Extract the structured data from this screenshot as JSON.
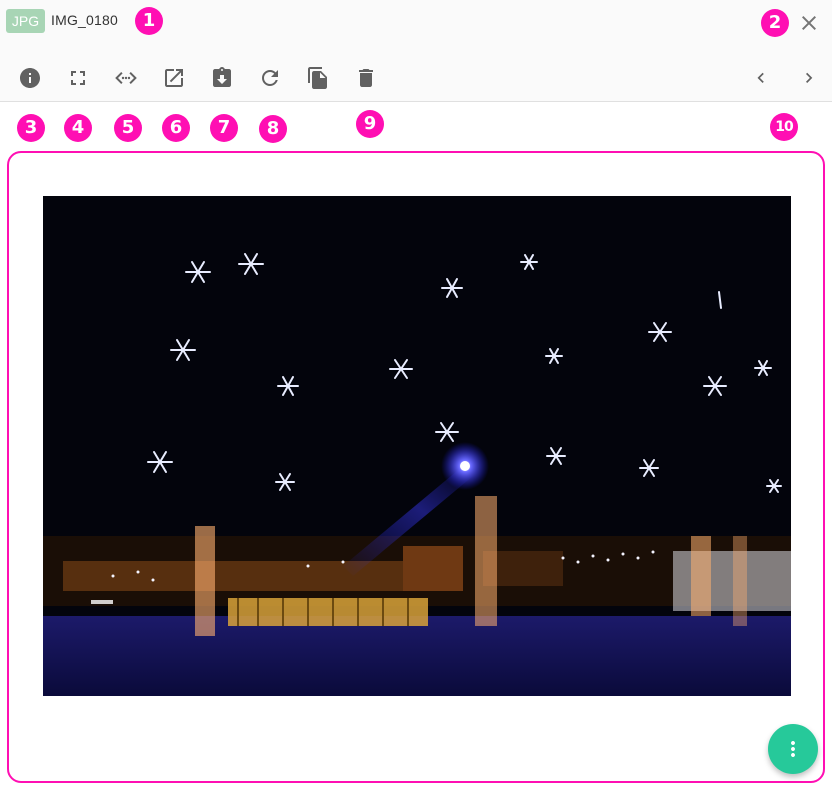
{
  "file": {
    "type_badge": "JPG",
    "name": "IMG_0180"
  },
  "toolbar": {
    "actions": [
      {
        "name": "info",
        "icon": "info-icon"
      },
      {
        "name": "fullscreen",
        "icon": "fullscreen-icon"
      },
      {
        "name": "embed",
        "icon": "code-icon"
      },
      {
        "name": "open-external",
        "icon": "open-in-new-icon"
      },
      {
        "name": "download",
        "icon": "download-icon"
      },
      {
        "name": "rotate",
        "icon": "refresh-icon"
      },
      {
        "name": "copy",
        "icon": "copy-icon"
      },
      {
        "name": "delete",
        "icon": "trash-icon"
      }
    ],
    "navigation": [
      {
        "name": "previous",
        "icon": "chevron-left-icon"
      },
      {
        "name": "next",
        "icon": "chevron-right-icon"
      }
    ],
    "close_icon": "close-icon"
  },
  "markers": [
    "1",
    "2",
    "3",
    "4",
    "5",
    "6",
    "7",
    "8",
    "9",
    "10"
  ],
  "colors": {
    "marker": "#ff0fb3",
    "badge": "#a8d5b5",
    "fab": "#26c99a",
    "icon": "#616161"
  },
  "fab": {
    "icon": "more-vertical-icon"
  },
  "preview": {
    "description_icon": "image-preview"
  }
}
